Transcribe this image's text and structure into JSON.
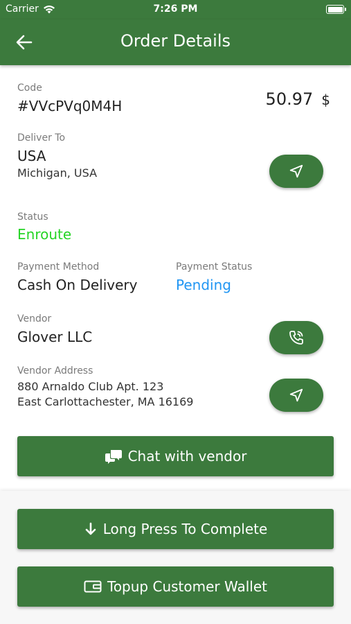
{
  "status_bar": {
    "carrier": "Carrier",
    "time": "7:26 PM"
  },
  "header": {
    "title": "Order Details"
  },
  "order": {
    "code_label": "Code",
    "code": "#VVcPVq0M4H",
    "amount": "50.97",
    "currency": "$"
  },
  "deliver": {
    "label": "Deliver To",
    "name": "USA",
    "address": "Michigan, USA"
  },
  "status": {
    "label": "Status",
    "value": "Enroute",
    "color": "#25d425"
  },
  "payment": {
    "method_label": "Payment Method",
    "method": "Cash On Delivery",
    "status_label": "Payment Status",
    "status": "Pending",
    "status_color": "#2196f3"
  },
  "vendor": {
    "label": "Vendor",
    "name": "Glover LLC",
    "address_label": "Vendor Address",
    "address_line1": "880 Arnaldo Club Apt. 123",
    "address_line2": "East Carlottachester, MA 16169"
  },
  "actions": {
    "chat": "Chat with vendor",
    "complete": "Long Press To Complete",
    "topup": "Topup Customer Wallet"
  },
  "theme": {
    "primary": "#3c7a3d"
  }
}
